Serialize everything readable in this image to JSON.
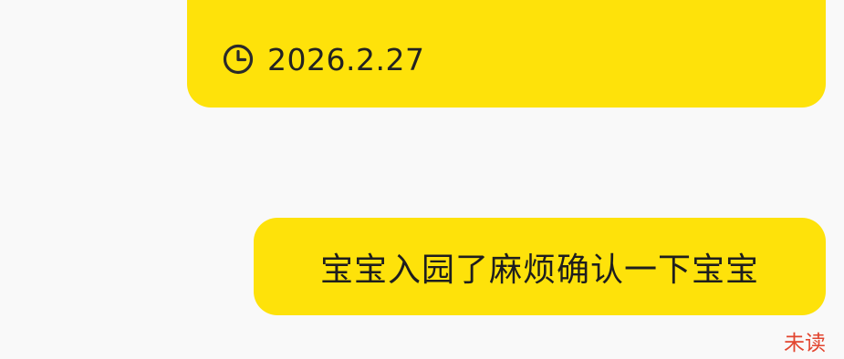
{
  "messages": [
    {
      "date_text": "2026.2.27",
      "date_icon": "clock-icon"
    },
    {
      "text": "宝宝入园了麻烦确认一下宝宝",
      "status": "未读",
      "status_color": "#e2452f"
    }
  ],
  "colors": {
    "bubble": "#fee20a",
    "background": "#f9f9f9",
    "text": "#222222"
  }
}
